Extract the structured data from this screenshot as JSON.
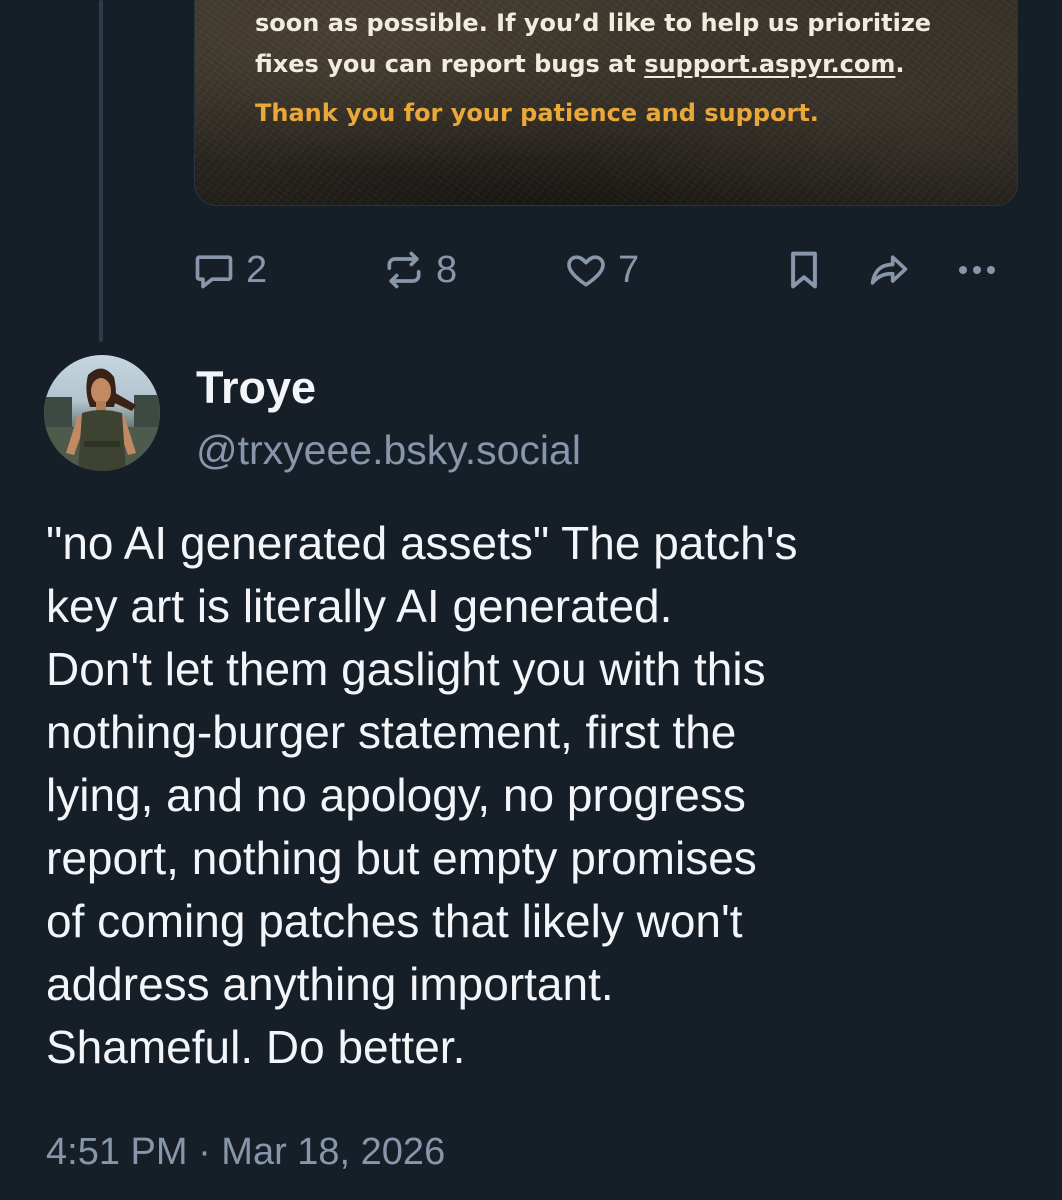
{
  "previous_post": {
    "embed": {
      "text_line_1": "soon as possible. If you’d like to help us prioritize",
      "text_line_2_prefix": "fixes you can report bugs at ",
      "text_line_2_link": "support.aspyr.com",
      "text_line_2_suffix": ".",
      "thanks": "Thank you for your patience and support."
    },
    "actions": {
      "reply_icon": "reply-bubble-icon",
      "reply_count": "2",
      "repost_icon": "repost-icon",
      "repost_count": "8",
      "like_icon": "heart-icon",
      "like_count": "7",
      "bookmark_icon": "bookmark-icon",
      "share_icon": "share-arrow-icon",
      "more_icon": "more-dots-icon"
    }
  },
  "post": {
    "author": {
      "display_name": "Troye",
      "handle": "@trxyeee.bsky.social"
    },
    "body_lines": [
      "\"no AI generated assets\" The patch's",
      "key art is literally AI generated.",
      "Don't let them gaslight you with this",
      "nothing-burger statement, first the",
      "lying, and no apology, no progress",
      "report, nothing but empty promises",
      "of coming patches that likely won't",
      "address anything important.",
      "Shameful. Do better."
    ],
    "timestamp": "4:51 PM · Mar 18, 2026"
  },
  "colors": {
    "background": "#161e27",
    "text_primary": "#f3f5f8",
    "text_secondary": "#8796aa",
    "embed_accent": "#e8a83a"
  }
}
